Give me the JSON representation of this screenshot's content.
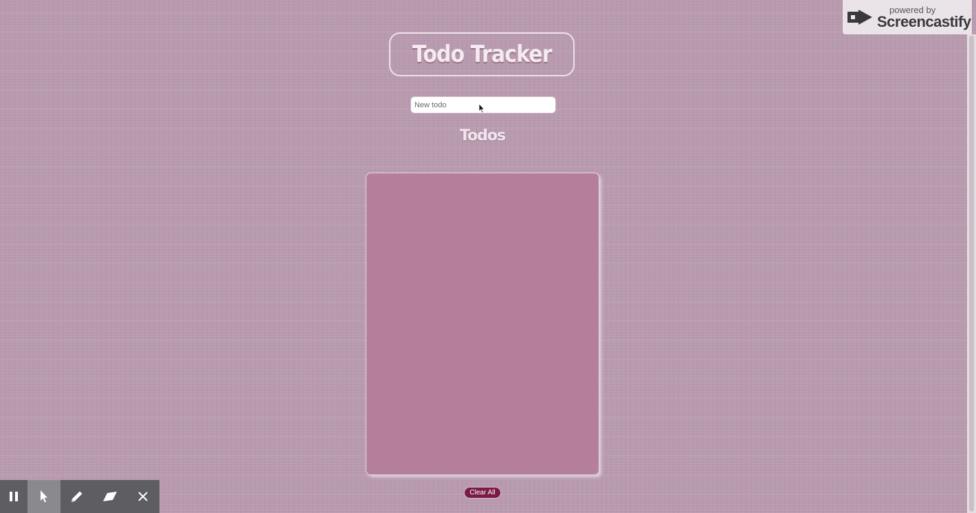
{
  "app": {
    "title": "Todo Tracker"
  },
  "new_todo": {
    "value": "",
    "placeholder": "New todo"
  },
  "todos": {
    "heading": "Todos",
    "items": []
  },
  "clear_all_label": "Clear All",
  "overlay": {
    "powered_by": "powered by",
    "brand": "Screencastify"
  },
  "recorder_toolbar": {
    "buttons": [
      {
        "name": "pause",
        "icon": "pause-icon",
        "active": false
      },
      {
        "name": "pointer",
        "icon": "cursor-icon",
        "active": true
      },
      {
        "name": "pen",
        "icon": "pencil-icon",
        "active": false
      },
      {
        "name": "eraser",
        "icon": "eraser-icon",
        "active": false
      },
      {
        "name": "close",
        "icon": "close-icon",
        "active": false
      }
    ]
  },
  "colors": {
    "page_background": "#b89aae",
    "list_background": "#b47e9a",
    "clear_button": "#7a1b44",
    "title_text": "#f4eaf0",
    "toolbar": "#5e5e62",
    "toolbar_active": "#8a8a8e"
  }
}
